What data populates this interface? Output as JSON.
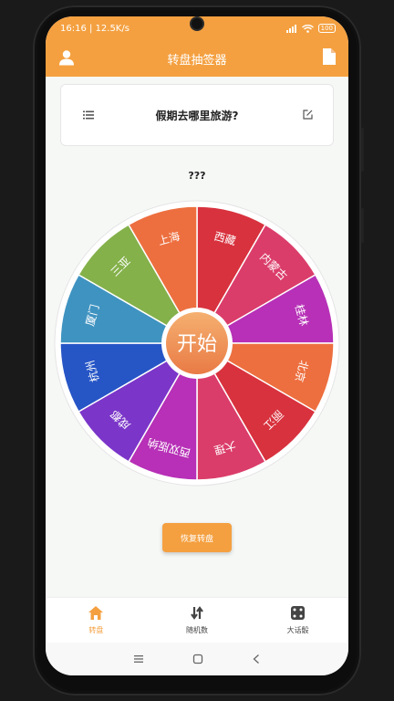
{
  "status_bar": {
    "time_speed": "16:16 | 12.5K/s",
    "battery": "100"
  },
  "app_bar": {
    "title": "转盘抽签器",
    "left_icon": "user-icon",
    "right_icon": "file-icon"
  },
  "question": {
    "text": "假期去哪里旅游?",
    "left_icon": "list-icon",
    "right_icon": "edit-icon"
  },
  "result_text": "???",
  "wheel": {
    "center_label": "开始",
    "segments": [
      {
        "label": "西藏",
        "color": "#d8323e"
      },
      {
        "label": "内蒙古",
        "color": "#db3d6a"
      },
      {
        "label": "桂林",
        "color": "#b730b7"
      },
      {
        "label": "北京",
        "color": "#ed6f3f"
      },
      {
        "label": "丽江",
        "color": "#d8323e"
      },
      {
        "label": "大理",
        "color": "#db3d6a"
      },
      {
        "label": "西双版纳",
        "color": "#b730b7"
      },
      {
        "label": "成都",
        "color": "#7b36c9"
      },
      {
        "label": "杭州",
        "color": "#2655c6"
      },
      {
        "label": "厦门",
        "color": "#3f93c1"
      },
      {
        "label": "三亚",
        "color": "#84b14a"
      },
      {
        "label": "上海",
        "color": "#ed6f3f"
      }
    ]
  },
  "restore_button": "恢复转盘",
  "bottom_nav": [
    {
      "label": "转盘",
      "icon": "home-icon",
      "active": true
    },
    {
      "label": "随机数",
      "icon": "shuffle-icon",
      "active": false
    },
    {
      "label": "大话骰",
      "icon": "dice-icon",
      "active": false
    }
  ],
  "system_nav": [
    "menu-icon",
    "home-square-icon",
    "back-icon"
  ],
  "colors": {
    "accent": "#f4a040",
    "center_gradient_top": "#f5b070",
    "center_gradient_bottom": "#e97a45"
  }
}
